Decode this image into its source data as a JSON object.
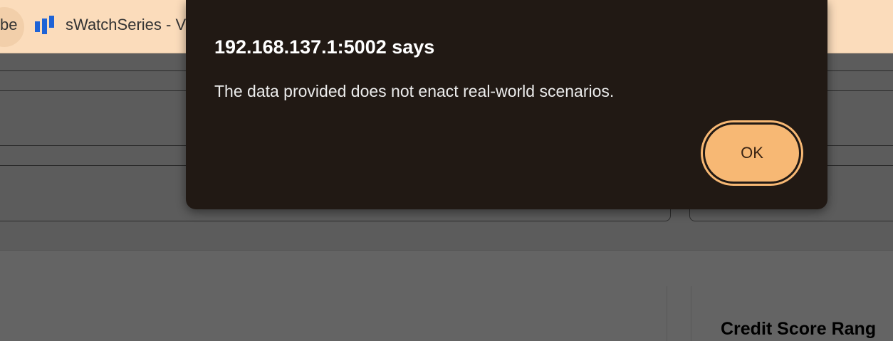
{
  "bookmarks_bar": {
    "partial_item_text": "be",
    "item": {
      "label": "sWatchSeries - V",
      "icon": "bars-chart-icon",
      "icon_color": "#1e63d6"
    }
  },
  "alert": {
    "title": "192.168.137.1:5002 says",
    "message": "The data provided does not enact real-world scenarios.",
    "ok_label": "OK"
  },
  "page": {
    "section_heading": "Credit Score Rang"
  },
  "colors": {
    "bookmarks_bar_bg": "#fbdcbb",
    "dialog_bg": "#211914",
    "ok_button_bg": "#f7b874",
    "page_dimmed_bg": "#5c5c5c"
  }
}
